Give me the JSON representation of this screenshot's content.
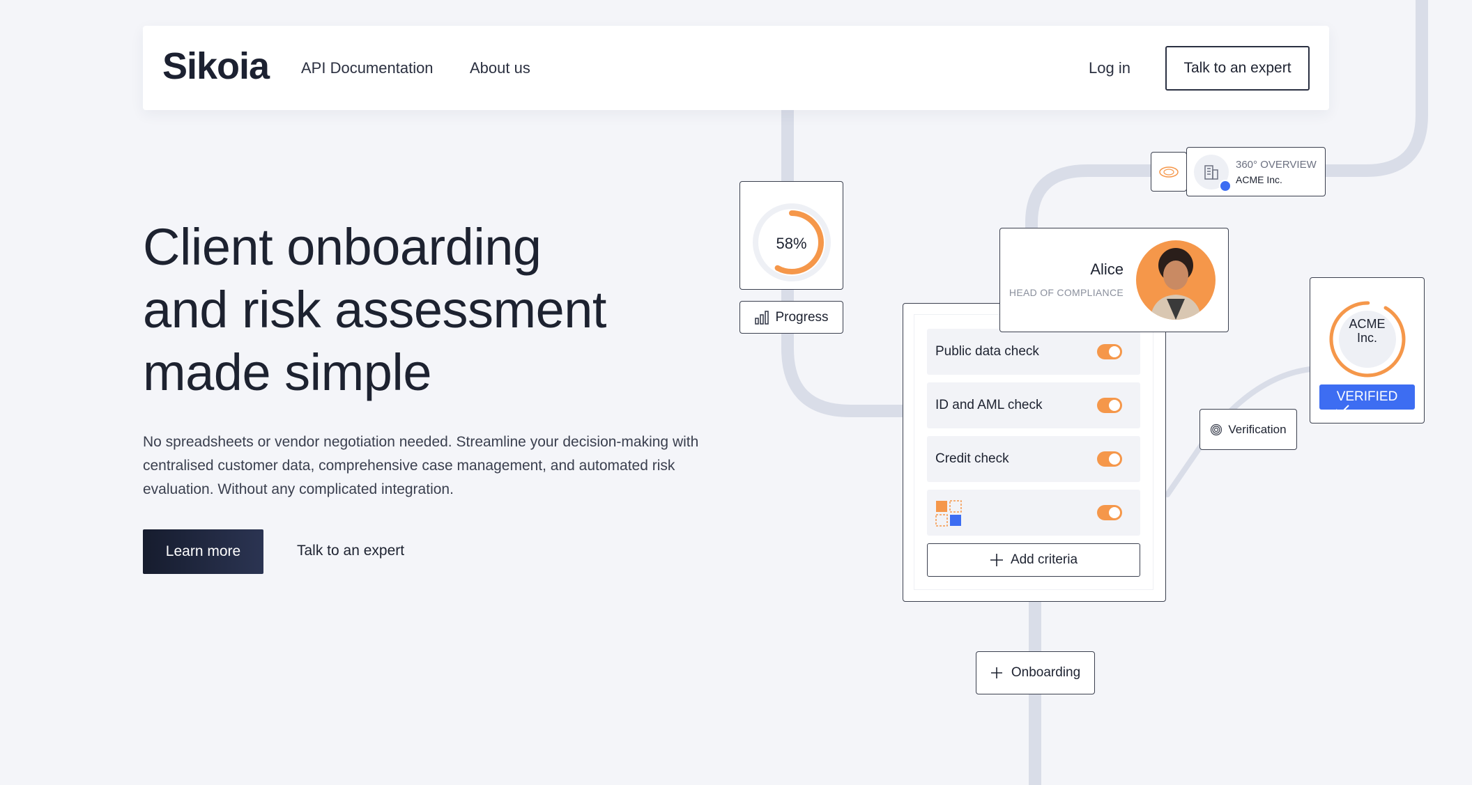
{
  "nav": {
    "logo": "Sikoia",
    "links": [
      "API Documentation",
      "About us"
    ],
    "login": "Log in",
    "cta": "Talk to an expert"
  },
  "hero": {
    "title_lines": [
      "Client onboarding",
      "and risk assessment",
      "made simple"
    ],
    "description": "No spreadsheets or vendor negotiation needed. Streamline your decision-making with centralised customer data, comprehensive case management, and automated risk evaluation. Without any complicated integration.",
    "primary_button": "Learn more",
    "secondary_button": "Talk to an expert"
  },
  "illustration": {
    "progress": {
      "value": "58%",
      "fraction": 0.58,
      "label": "Progress"
    },
    "overview": {
      "title": "360° OVERVIEW",
      "company": "ACME Inc."
    },
    "person": {
      "name": "Alice",
      "role": "HEAD OF COMPLIANCE"
    },
    "checks": [
      {
        "label": "Public data check",
        "enabled": true
      },
      {
        "label": "ID and AML check",
        "enabled": true
      },
      {
        "label": "Credit check",
        "enabled": true
      },
      {
        "label": "",
        "enabled": true
      }
    ],
    "add_criteria": "Add criteria",
    "company": {
      "name_line1": "ACME",
      "name_line2": "Inc.",
      "status": "VERIFIED"
    },
    "verification": "Verification",
    "onboarding": "Onboarding"
  },
  "colors": {
    "accent_orange": "#f5974a",
    "accent_blue": "#3d6df2",
    "dark_navy": "#1d2230",
    "background": "#f4f5f9",
    "connector": "#d9dde8"
  }
}
